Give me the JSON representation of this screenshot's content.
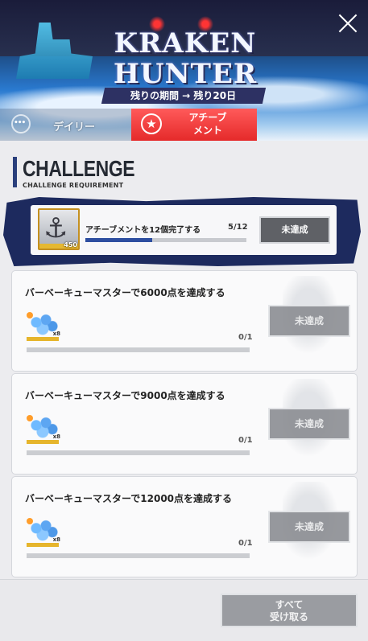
{
  "banner": {
    "title_line1": "KRAKEN",
    "title_line2": "HUNTER",
    "period": "残りの期間 → 残り20日"
  },
  "tabs": [
    {
      "label": "デイリー",
      "active": false
    },
    {
      "label": "アチーブ\nメント",
      "active": true
    }
  ],
  "section": {
    "heading": "CHALLENGE",
    "subheading": "CHALLENGE REQUIREMENT"
  },
  "main_challenge": {
    "task": "アチーブメントを12個完了する",
    "progress_text": "5/12",
    "progress_fraction": 0.4167,
    "reward_qty": "450",
    "status_label": "未達成"
  },
  "challenges": [
    {
      "task": "バーベーキューマスターで6000点を達成する",
      "progress_text": "0/1",
      "reward_qty": "x8",
      "status_label": "未達成"
    },
    {
      "task": "バーベーキューマスターで9000点を達成する",
      "progress_text": "0/1",
      "reward_qty": "x8",
      "status_label": "未達成"
    },
    {
      "task": "バーベーキューマスターで12000点を達成する",
      "progress_text": "0/1",
      "reward_qty": "x8",
      "status_label": "未達成"
    }
  ],
  "footer": {
    "receive_all_label_line1": "すべて",
    "receive_all_label_line2": "受け取る"
  },
  "colors": {
    "accent_tab": "#e52a2a",
    "navy": "#1d2a5e",
    "progress_fill": "#2d4ea0"
  },
  "icons": [
    "close-icon",
    "daily-icon",
    "star-icon",
    "anchor-icon",
    "cube-reward-icon"
  ]
}
